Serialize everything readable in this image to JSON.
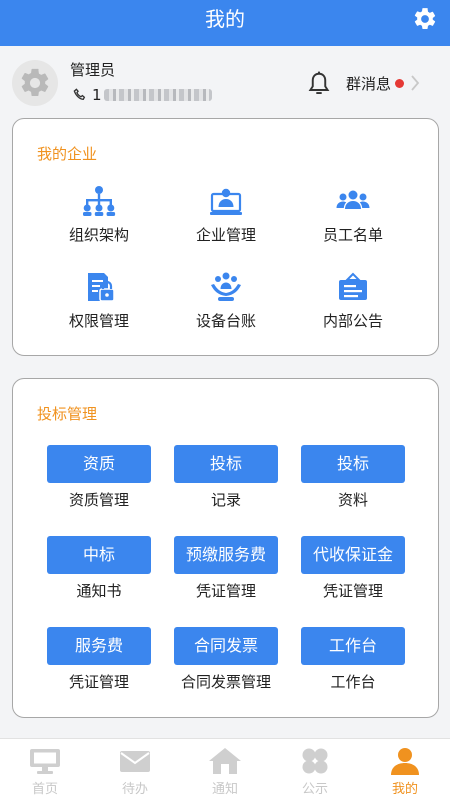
{
  "header": {
    "title": "我的",
    "settings_icon": "gear-icon"
  },
  "profile": {
    "name": "管理员",
    "phone_prefix": "1",
    "phone_icon": "phone-icon",
    "bell_icon": "bell-icon",
    "group_message_label": "群消息"
  },
  "enterprise": {
    "title": "我的企业",
    "items": [
      {
        "label": "组织架构",
        "icon": "org-chart-icon"
      },
      {
        "label": "企业管理",
        "icon": "enterprise-manage-icon"
      },
      {
        "label": "员工名单",
        "icon": "employees-icon"
      },
      {
        "label": "权限管理",
        "icon": "permission-lock-icon"
      },
      {
        "label": "设备台账",
        "icon": "device-ledger-icon"
      },
      {
        "label": "内部公告",
        "icon": "notice-board-icon"
      }
    ]
  },
  "bidding": {
    "title": "投标管理",
    "items": [
      {
        "button": "资质",
        "caption": "资质管理"
      },
      {
        "button": "投标",
        "caption": "记录"
      },
      {
        "button": "投标",
        "caption": "资料"
      },
      {
        "button": "中标",
        "caption": "通知书"
      },
      {
        "button": "预缴服务费",
        "caption": "凭证管理"
      },
      {
        "button": "代收保证金",
        "caption": "凭证管理"
      },
      {
        "button": "服务费",
        "caption": "凭证管理"
      },
      {
        "button": "合同发票",
        "caption": "合同发票管理"
      },
      {
        "button": "工作台",
        "caption": "工作台"
      }
    ]
  },
  "tabbar": {
    "tabs": [
      {
        "label": "首页",
        "icon": "monitor-icon"
      },
      {
        "label": "待办",
        "icon": "envelope-icon"
      },
      {
        "label": "通知",
        "icon": "house-icon"
      },
      {
        "label": "公示",
        "icon": "clover-icon"
      },
      {
        "label": "我的",
        "icon": "person-icon"
      }
    ],
    "active": "我的"
  },
  "colors": {
    "primary": "#3b86ee",
    "accent": "#f0921f",
    "badge": "#e53935",
    "inactive_tab": "#c8c8c8"
  }
}
